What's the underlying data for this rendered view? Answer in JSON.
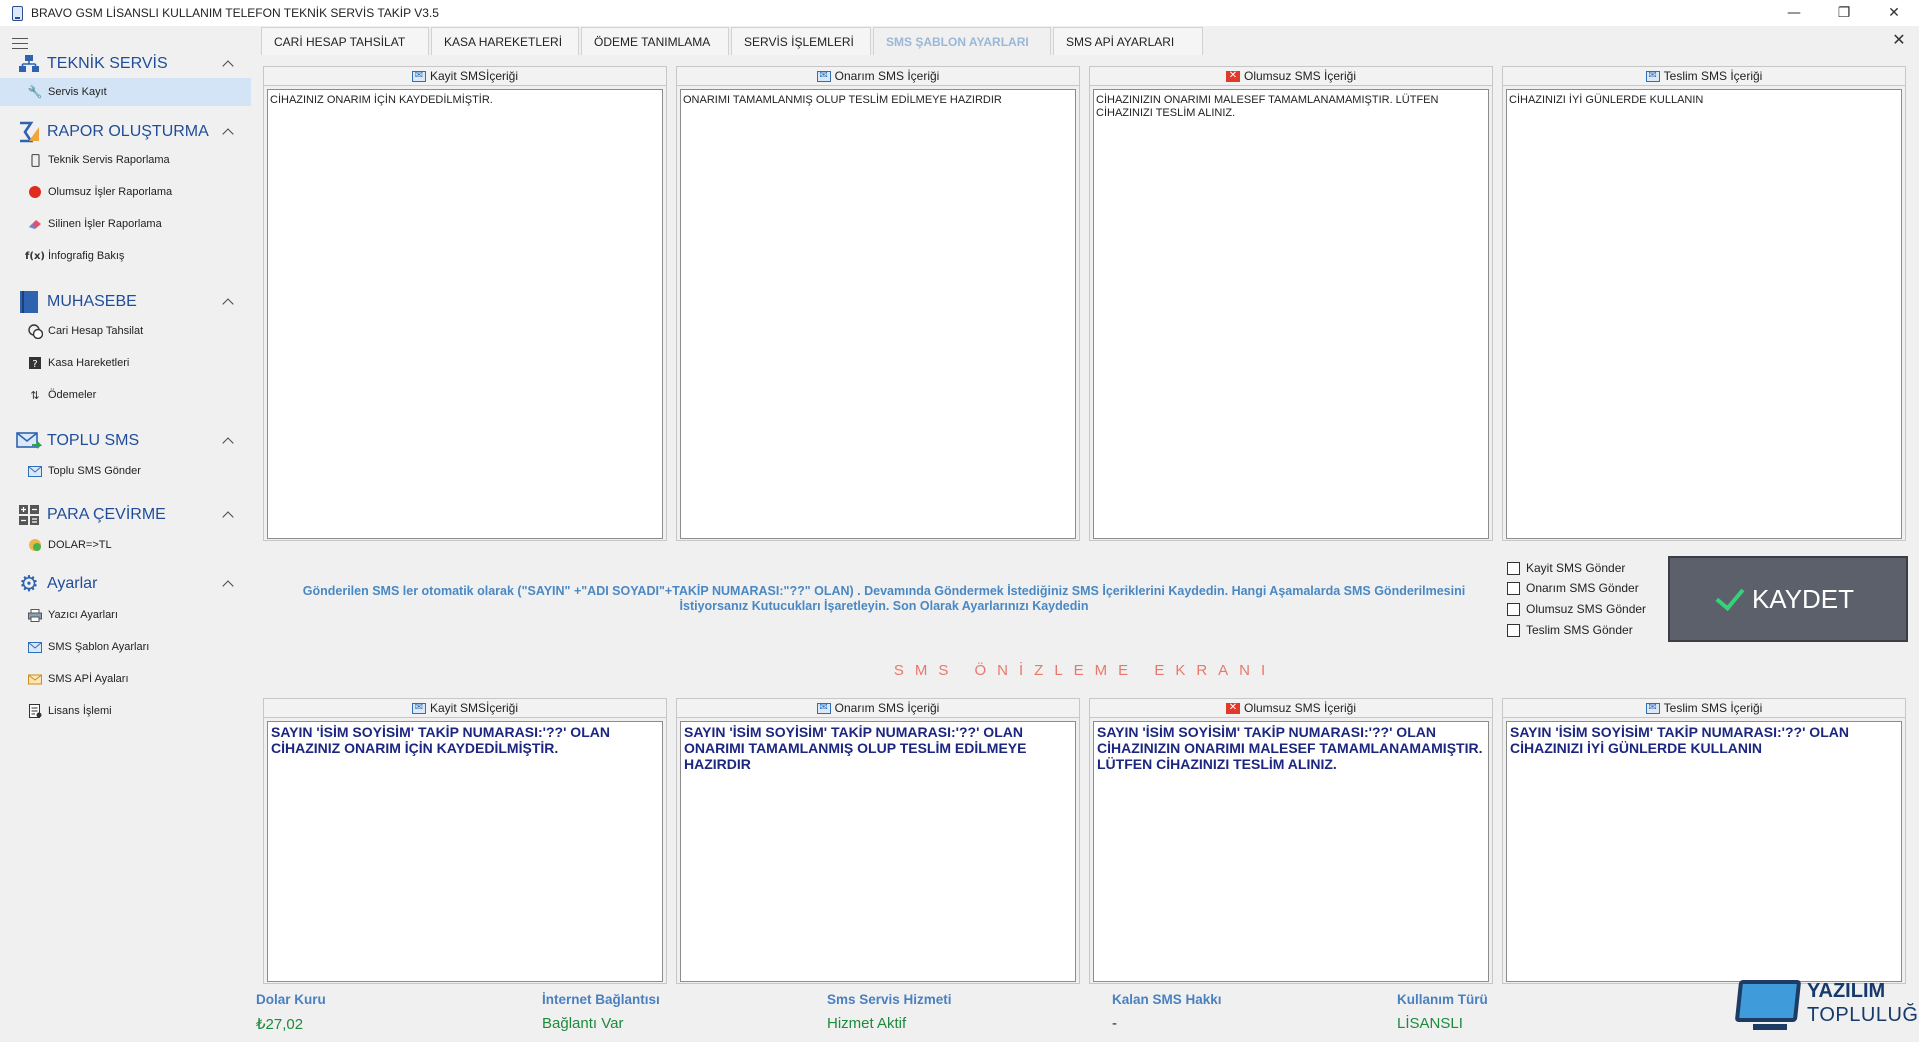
{
  "window": {
    "title": "BRAVO GSM LİSANSLI KULLANIM TELEFON TEKNİK SERVİS TAKİP V3.5",
    "minimize": "—",
    "restore": "❐",
    "close": "✕"
  },
  "sidebar": {
    "sections": [
      {
        "label": "TEKNİK SERVİS",
        "icon": "network-icon",
        "items": [
          {
            "label": "Servis Kayıt",
            "icon": "wrench-icon",
            "active": true
          }
        ]
      },
      {
        "label": "RAPOR OLUŞTURMA",
        "icon": "sigma-chart-icon",
        "items": [
          {
            "label": "Teknik Servis Raporlama",
            "icon": "phone-icon"
          },
          {
            "label": "Olumsuz İşler Raporlama",
            "icon": "red-circle-icon"
          },
          {
            "label": "Silinen İşler Raporlama",
            "icon": "eraser-icon"
          },
          {
            "label": "İnfografig Bakış",
            "icon": "function-icon"
          }
        ]
      },
      {
        "label": "MUHASEBE",
        "icon": "book-icon",
        "items": [
          {
            "label": "Cari Hesap Tahsilat",
            "icon": "coins-icon"
          },
          {
            "label": "Kasa Hareketleri",
            "icon": "question-box-icon"
          },
          {
            "label": "Ödemeler",
            "icon": "sort-icon"
          }
        ]
      },
      {
        "label": "TOPLU SMS",
        "icon": "envelope-arrow-icon",
        "items": [
          {
            "label": "Toplu SMS Gönder",
            "icon": "envelope-icon"
          }
        ]
      },
      {
        "label": "PARA ÇEVİRME",
        "icon": "calculator-icon",
        "items": [
          {
            "label": "DOLAR=>TL",
            "icon": "money-icon"
          }
        ]
      },
      {
        "label": "Ayarlar",
        "icon": "gear-icon",
        "items": [
          {
            "label": "Yazıcı Ayarları",
            "icon": "printer-icon"
          },
          {
            "label": "SMS Şablon Ayarları",
            "icon": "envelope-icon"
          },
          {
            "label": "SMS APİ Ayaları",
            "icon": "sms-api-icon"
          },
          {
            "label": "Lisans İşlemi",
            "icon": "license-icon"
          }
        ]
      }
    ]
  },
  "tabs": [
    {
      "label": "CARİ HESAP TAHSİLAT",
      "active": false
    },
    {
      "label": "KASA HAREKETLERİ",
      "active": false
    },
    {
      "label": "ÖDEME TANIMLAMA",
      "active": false
    },
    {
      "label": "SERVİS İŞLEMLERİ",
      "active": false
    },
    {
      "label": "SMS ŞABLON AYARLARI",
      "active": true
    },
    {
      "label": "SMS APİ AYARLARI",
      "active": false
    }
  ],
  "main_close": "✕",
  "templates": [
    {
      "title": "Kayit SMSİçeriği",
      "icon": "envelope-icon",
      "text": "CİHAZINIZ ONARIM İÇİN KAYDEDİLMİŞTİR."
    },
    {
      "title": "Onarım SMS İçeriği",
      "icon": "envelope-icon",
      "text": "ONARIMI TAMAMLANMIŞ OLUP TESLİM EDİLMEYE HAZIRDIR"
    },
    {
      "title": "Olumsuz SMS İçeriği",
      "icon": "red-x-icon",
      "text": "CİHAZINIZIN ONARIMI MALESEF TAMAMLANAMAMIŞTIR. LÜTFEN CİHAZINIZI TESLİM ALINIZ."
    },
    {
      "title": "Teslim SMS İçeriği",
      "icon": "envelope-icon",
      "text": "CİHAZINIZI İYİ GÜNLERDE KULLANIN"
    }
  ],
  "info_text": "Gönderilen SMS ler otomatik olarak (\"SAYIN\" +\"ADI SOYADI\"+TAKİP NUMARASI:\"??\" OLAN) .  Devamında Göndermek İstediğiniz SMS İçeriklerini Kaydedin. Hangi Aşamalarda SMS Gönderilmesini İstiyorsanız Kutucukları İşaretleyin. Son Olarak Ayarlarınızı Kaydedin",
  "checkboxes": [
    {
      "label": "Kayit SMS Gönder",
      "checked": false
    },
    {
      "label": "Onarım SMS Gönder",
      "checked": false
    },
    {
      "label": "Olumsuz SMS Gönder",
      "checked": false
    },
    {
      "label": "Teslim SMS Gönder",
      "checked": false
    }
  ],
  "save_button": "KAYDET",
  "preview_title": "SMS ÖNİZLEME EKRANI",
  "previews": [
    {
      "title": "Kayit SMSİçeriği",
      "icon": "envelope-icon",
      "text": "SAYIN 'İSİM SOYİSİM' TAKİP NUMARASI:'??' OLAN CİHAZINIZ ONARIM İÇİN KAYDEDİLMİŞTİR."
    },
    {
      "title": "Onarım SMS İçeriği",
      "icon": "envelope-icon",
      "text": "SAYIN 'İSİM SOYİSİM' TAKİP NUMARASI:'??' OLAN ONARIMI TAMAMLANMIŞ OLUP TESLİM EDİLMEYE HAZIRDIR"
    },
    {
      "title": "Olumsuz SMS İçeriği",
      "icon": "red-x-icon",
      "text": "SAYIN 'İSİM SOYİSİM' TAKİP NUMARASI:'??' OLAN CİHAZINIZIN ONARIMI MALESEF TAMAMLANAMAMIŞTIR. LÜTFEN CİHAZINIZI TESLİM ALINIZ."
    },
    {
      "title": "Teslim SMS İçeriği",
      "icon": "envelope-icon",
      "text": "SAYIN 'İSİM SOYİSİM' TAKİP NUMARASI:'??' OLAN CİHAZINIZI İYİ GÜNLERDE KULLANIN"
    }
  ],
  "status": [
    {
      "label": "Dolar Kuru",
      "value": "₺27,02",
      "value_color": "#1e8a3c"
    },
    {
      "label": "İnternet Bağlantısı",
      "value": "Bağlantı Var",
      "value_color": "#1e8a3c"
    },
    {
      "label": "Sms Servis Hizmeti",
      "value": "Hizmet Aktif",
      "value_color": "#1e8a3c"
    },
    {
      "label": "Kalan SMS Hakkı",
      "value": "-",
      "value_color": "#222222"
    },
    {
      "label": "Kullanım Türü",
      "value": "LİSANSLI",
      "value_color": "#1e8a3c"
    }
  ],
  "watermark": {
    "line1": "YAZILIM",
    "line2": "TOPLULUĞU"
  }
}
